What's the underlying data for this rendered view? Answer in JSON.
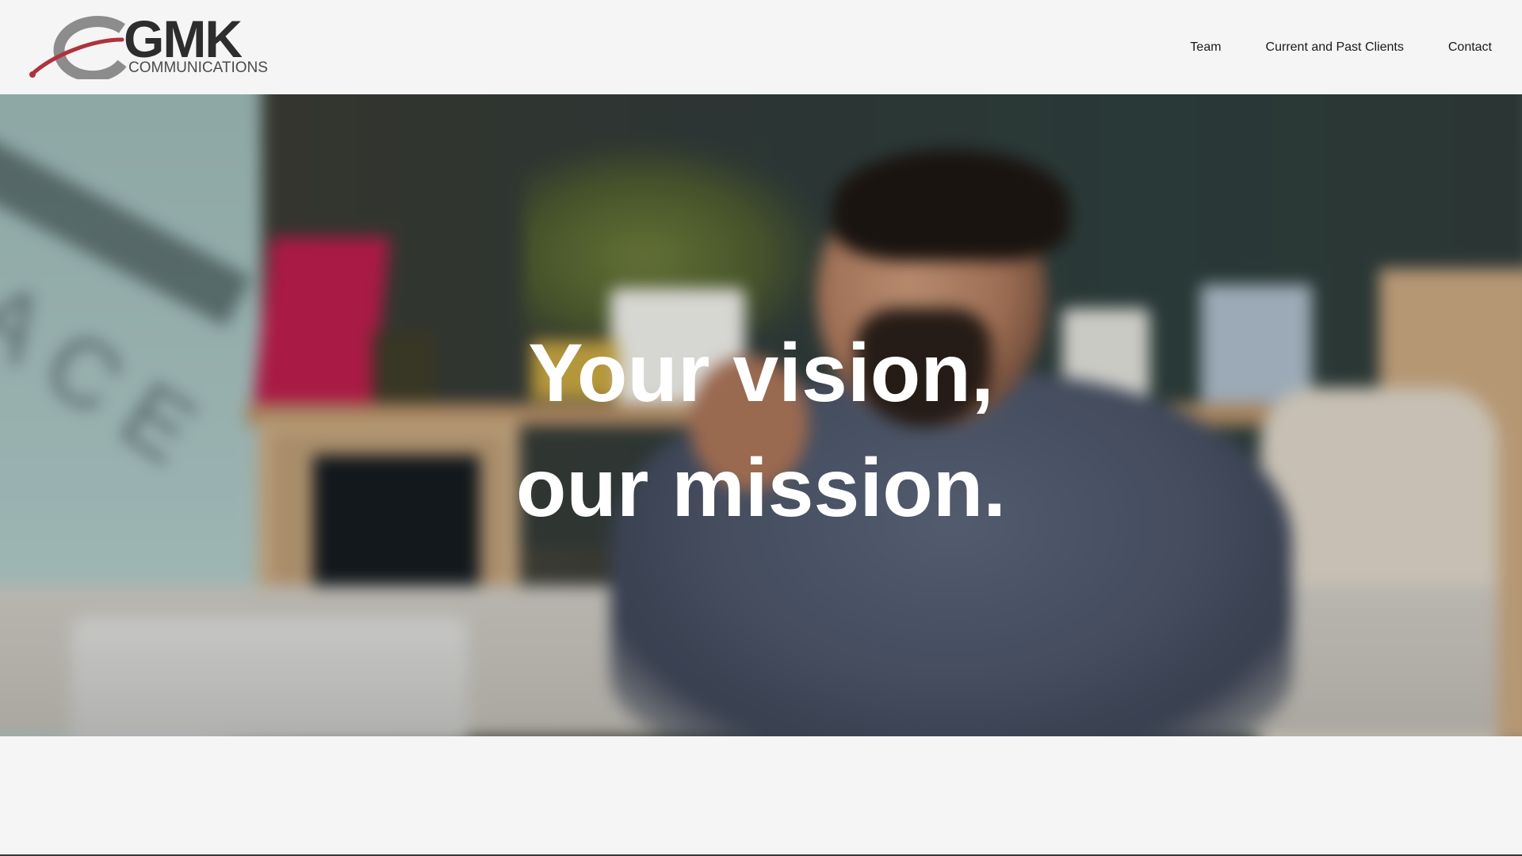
{
  "header": {
    "logo": {
      "wordmark": "GMK",
      "subtitle": "COMMUNICATIONS"
    },
    "nav": [
      {
        "label": "Team"
      },
      {
        "label": "Current and Past Clients"
      },
      {
        "label": "Contact"
      }
    ]
  },
  "hero": {
    "headline_line1": "Your vision,",
    "headline_line2": "our mission."
  },
  "colors": {
    "background": "#f5f5f5",
    "logo_accent": "#b0323c",
    "logo_text": "#2d2d2d",
    "nav_text": "#1a1a1a",
    "headline_text": "#ffffff"
  }
}
